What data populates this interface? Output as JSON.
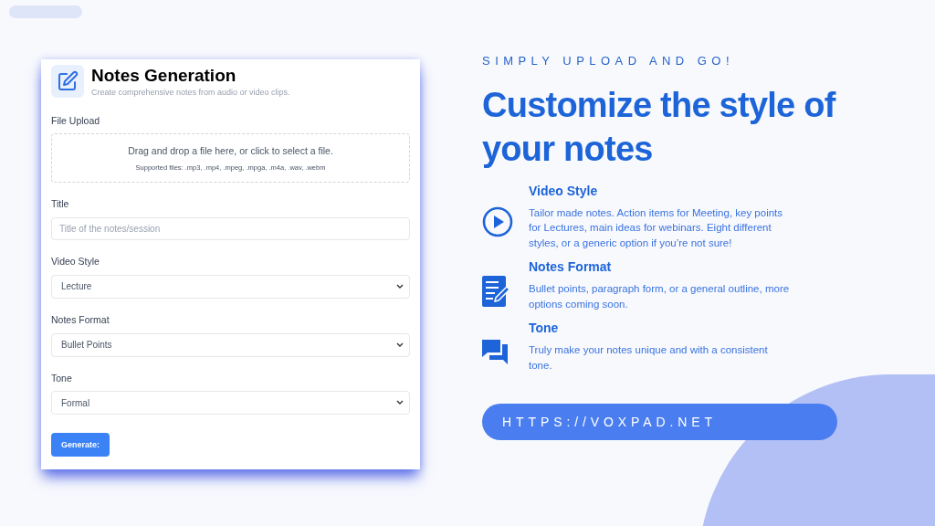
{
  "form": {
    "title": "Notes Generation",
    "subtitle": "Create comprehensive notes from audio or video clips.",
    "upload": {
      "label": "File Upload",
      "prompt": "Drag and drop a file here, or click to select a file.",
      "hint": "Supported files: .mp3, .mp4, .mpeg, .mpga, .m4a, .wav, .webm"
    },
    "title_field": {
      "label": "Title",
      "placeholder": "Title of the notes/session"
    },
    "selects": [
      {
        "label": "Video Style",
        "value": "Lecture"
      },
      {
        "label": "Notes Format",
        "value": "Bullet Points"
      },
      {
        "label": "Tone",
        "value": "Formal"
      }
    ],
    "button": "Generate:"
  },
  "tagline": "SIMPLY UPLOAD AND GO!",
  "headline": "Customize the style of your notes",
  "features": [
    {
      "kind": "play",
      "title": "Video Style",
      "text": "Tailor made notes. Action items for Meeting, key points for Lectures, main ideas for webinars. Eight different styles, or a generic option if you’re not sure!"
    },
    {
      "kind": "document",
      "title": "Notes Format",
      "text": "Bullet points, paragraph form, or a general outline, more options coming soon."
    },
    {
      "kind": "chat",
      "title": "Tone",
      "text": "Truly make your notes unique and with a consistent tone."
    }
  ],
  "url": "HTTPS://VOXPAD.NET"
}
